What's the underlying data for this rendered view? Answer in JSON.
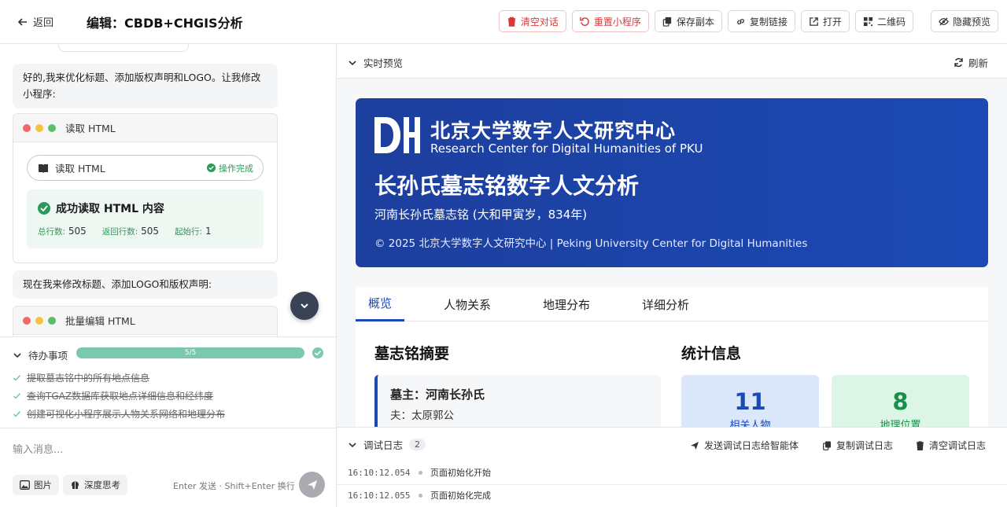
{
  "header": {
    "back_label": "返回",
    "title": "编辑：CBDB+CHGIS分析",
    "buttons": [
      "清空对话",
      "重置小程序",
      "保存副本",
      "复制链接",
      "打开",
      "二维码",
      "隐藏预览"
    ]
  },
  "chat": {
    "msg1": "好的,我来优化标题、添加版权声明和LOGO。让我修改小程序:",
    "tool1": {
      "title": "读取 HTML",
      "pill_label": "读取 HTML",
      "status": "操作完成",
      "result_title": "成功读取 HTML 内容",
      "stats": [
        {
          "label": "总行数:",
          "value": "505"
        },
        {
          "label": "返回行数:",
          "value": "505"
        },
        {
          "label": "起始行:",
          "value": "1"
        }
      ]
    },
    "msg2": "现在我来修改标题、添加LOGO和版权声明:",
    "tool2": {
      "title": "批量编辑 HTML"
    }
  },
  "todo": {
    "title": "待办事项",
    "progress_label": "5/5",
    "progress": 1.0,
    "items": [
      "提取墓志铭中的所有地点信息",
      "查询TGAZ数据库获取地点详细信息和经纬度",
      "创建可视化小程序展示人物关系网络和地理分布"
    ]
  },
  "input": {
    "placeholder": "输入消息...",
    "image_btn": "图片",
    "think_btn": "深度思考",
    "hint": "Enter 发送 · Shift+Enter 换行"
  },
  "preview": {
    "label": "实时预览",
    "refresh": "刷新",
    "banner": {
      "logo_text": "DH",
      "org_cn": "北京大学数字人文研究中心",
      "org_en": "Research Center for Digital Humanities of PKU",
      "title": "长孙氏墓志铭数字人文分析",
      "subtitle": "河南长孙氏墓志铭 (大和甲寅岁，834年)",
      "copyright": "© 2025 北京大学数字人文研究中心 | Peking University Center for Digital Humanities"
    },
    "tabs": [
      "概览",
      "人物关系",
      "地理分布",
      "详细分析"
    ],
    "summary_title": "墓志铭摘要",
    "card_title": "墓主：河南长孙氏",
    "card_line": "夫：太原郭公",
    "stats_title": "统计信息",
    "stats": [
      {
        "value": "11",
        "label": "相关人物"
      },
      {
        "value": "8",
        "label": "地理位置"
      }
    ],
    "colors": {
      "accent": "#1c49b4",
      "stat1_bg": "#dbe7fb",
      "stat2_bg": "#dcf5e6",
      "stat2_fg": "#17914a"
    }
  },
  "debug": {
    "title": "调试日志",
    "count": "2",
    "send_label": "发送调试日志给智能体",
    "copy_label": "复制调试日志",
    "clear_label": "清空调试日志",
    "logs": [
      {
        "time": "16:10:12.054",
        "msg": "页面初始化开始"
      },
      {
        "time": "16:10:12.055",
        "msg": "页面初始化完成"
      }
    ]
  }
}
